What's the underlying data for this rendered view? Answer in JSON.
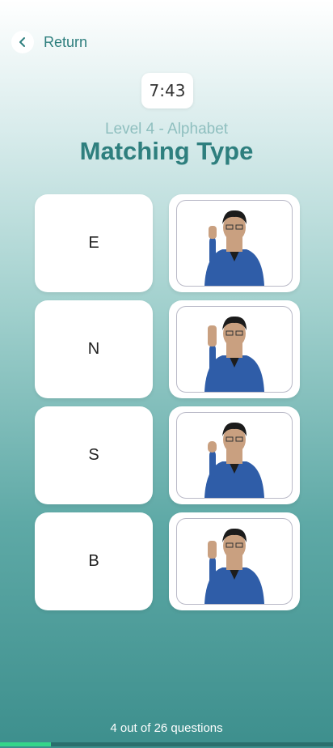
{
  "header": {
    "return_label": "Return",
    "back_icon": "chevron-left-icon"
  },
  "timer": "7:43",
  "level_subtitle": "Level 4 - Alphabet",
  "title": "Matching Type",
  "cards": [
    {
      "letter": "E",
      "image_icon": "person-signing-icon"
    },
    {
      "letter": "N",
      "image_icon": "person-signing-icon"
    },
    {
      "letter": "S",
      "image_icon": "person-signing-icon"
    },
    {
      "letter": "B",
      "image_icon": "person-signing-icon"
    }
  ],
  "footer": {
    "progress_text": "4 out of 26 questions",
    "progress_fraction": 0.1538
  },
  "colors": {
    "accent": "#2e7f7e",
    "progress": "#34d58a"
  }
}
